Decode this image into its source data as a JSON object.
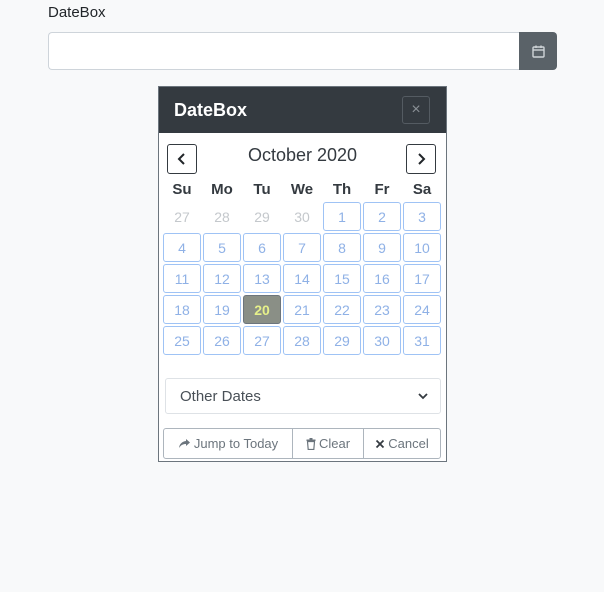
{
  "field": {
    "label": "DateBox",
    "value": "",
    "button_icon": "calendar-icon"
  },
  "popup": {
    "title": "DateBox",
    "close_label": "×",
    "month_title": "October 2020",
    "weekdays": [
      "Su",
      "Mo",
      "Tu",
      "We",
      "Th",
      "Fr",
      "Sa"
    ],
    "weeks": [
      [
        "27",
        "28",
        "29",
        "30",
        "1",
        "2",
        "3"
      ],
      [
        "4",
        "5",
        "6",
        "7",
        "8",
        "9",
        "10"
      ],
      [
        "11",
        "12",
        "13",
        "14",
        "15",
        "16",
        "17"
      ],
      [
        "18",
        "19",
        "20",
        "21",
        "22",
        "23",
        "24"
      ],
      [
        "25",
        "26",
        "27",
        "28",
        "29",
        "30",
        "31"
      ]
    ],
    "outside_month_days": [
      "27",
      "28",
      "29",
      "30"
    ],
    "selected_day": "20",
    "other_dates_label": "Other Dates",
    "footer": {
      "jump_label": "Jump to Today",
      "clear_label": "Clear",
      "cancel_label": "Cancel"
    }
  },
  "colors": {
    "header_bg": "#343a40",
    "day_border": "#9fc3f5",
    "selected_bg": "#8a8f86",
    "selected_text": "#e6f08a"
  }
}
